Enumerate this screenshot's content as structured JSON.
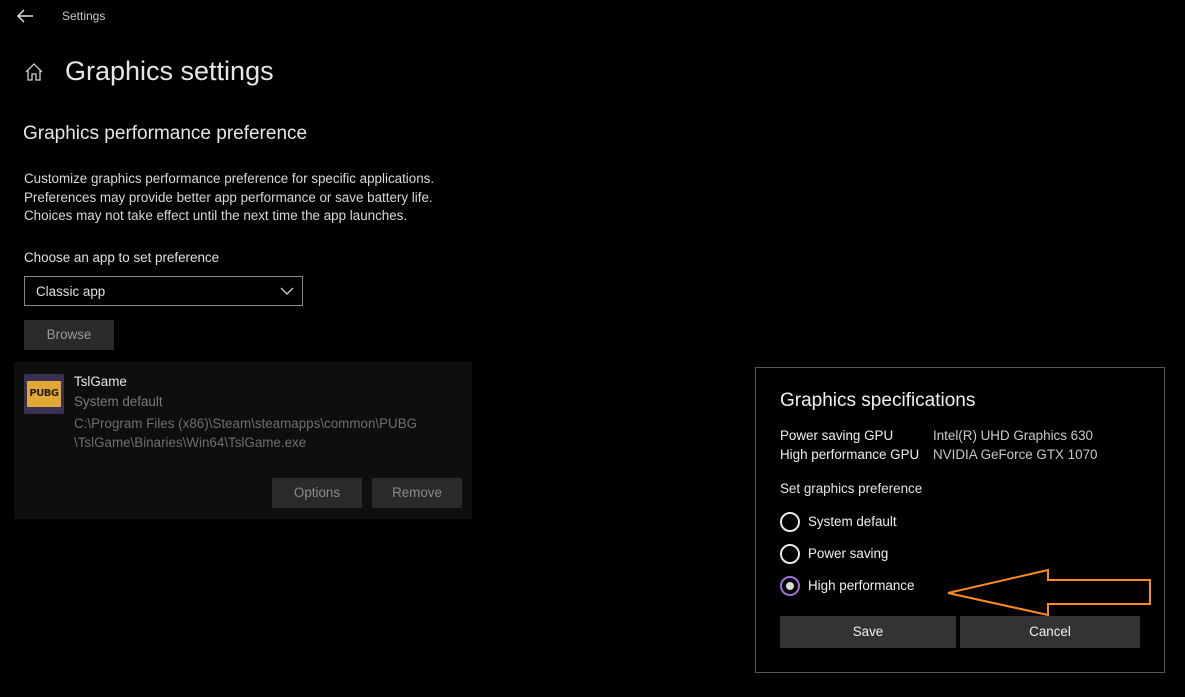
{
  "window": {
    "title": "Settings"
  },
  "header": {
    "page_title": "Graphics settings"
  },
  "section": {
    "title": "Graphics performance preference",
    "description": [
      "Customize graphics performance preference for specific applications.",
      "Preferences may provide better app performance or save battery life.",
      "Choices may not take effect until the next time the app launches."
    ]
  },
  "chooser": {
    "label": "Choose an app to set preference",
    "selected": "Classic app",
    "browse_label": "Browse"
  },
  "app": {
    "icon_text": "PUBG",
    "name": "TslGame",
    "preference": "System default",
    "path_line1": "C:\\Program Files (x86)\\Steam\\steamapps\\common\\PUBG",
    "path_line2": "\\TslGame\\Binaries\\Win64\\TslGame.exe",
    "options_label": "Options",
    "remove_label": "Remove"
  },
  "dialog": {
    "title": "Graphics specifications",
    "specs": [
      {
        "label": "Power saving GPU",
        "value": "Intel(R) UHD Graphics 630"
      },
      {
        "label": "High performance GPU",
        "value": "NVIDIA GeForce GTX 1070"
      }
    ],
    "pref_label": "Set graphics preference",
    "options": [
      {
        "label": "System default",
        "checked": false
      },
      {
        "label": "Power saving",
        "checked": false
      },
      {
        "label": "High performance",
        "checked": true
      }
    ],
    "save_label": "Save",
    "cancel_label": "Cancel"
  },
  "annotation": {
    "arrow_color": "#ff8a1e"
  },
  "colors": {
    "radio_accent": "#9b6fd6"
  }
}
